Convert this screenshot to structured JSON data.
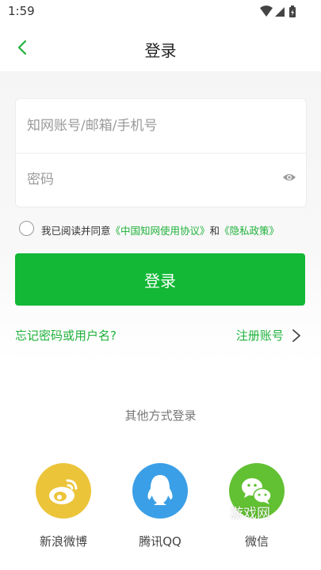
{
  "status_bar": {
    "time": "1:59",
    "icons": [
      "wifi-icon",
      "signal-icon",
      "battery-icon"
    ]
  },
  "nav": {
    "title": "登录",
    "back_icon": "back-arrow-icon"
  },
  "form": {
    "account_placeholder": "知网账号/邮箱/手机号",
    "account_value": "",
    "password_placeholder": "密码",
    "password_value": "",
    "password_visibility_icon": "eye-icon"
  },
  "agreement": {
    "checked": false,
    "prefix": "我已阅读并同意",
    "terms_link": "《中国知网使用协议》",
    "conjunction": "和",
    "privacy_link": "《隐私政策》"
  },
  "login_button": "登录",
  "links": {
    "forgot": "忘记密码或用户名?",
    "register": "注册账号",
    "register_icon": "chevron-right-icon"
  },
  "other_login": {
    "title": "其他方式登录",
    "options": [
      {
        "label": "新浪微博",
        "icon": "weibo-icon",
        "color": "#ebc43a"
      },
      {
        "label": "腾讯QQ",
        "icon": "qq-icon",
        "color": "#3a9fe6"
      },
      {
        "label": "微信",
        "icon": "wechat-icon",
        "color": "#62c132"
      }
    ]
  },
  "watermark": "游戏网",
  "colors": {
    "accent": "#12b836",
    "link": "#1fb23a"
  }
}
